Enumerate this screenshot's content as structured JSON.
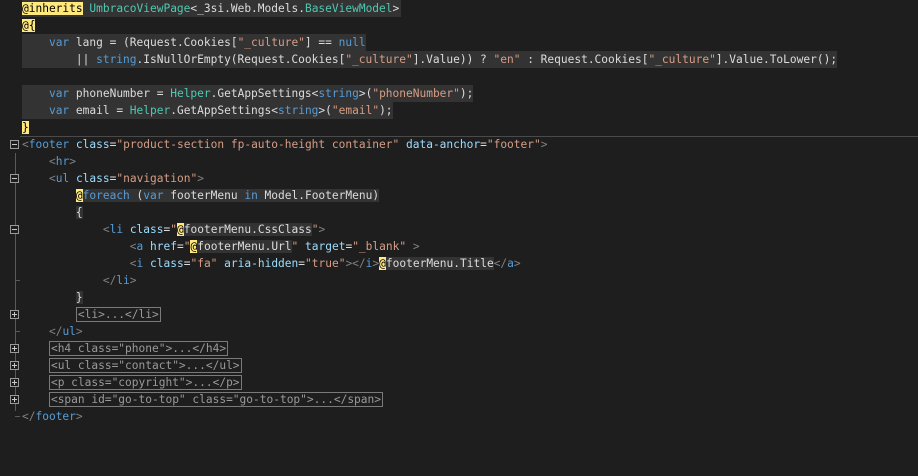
{
  "editor": {
    "lines": [
      {
        "text": "@inherits UmbracoViewPage<_3si.Web.Models.BaseViewModel>"
      },
      {
        "text": "@{"
      },
      {
        "text": "    var lang = (Request.Cookies[\"_culture\"] == null"
      },
      {
        "text": "        || string.IsNullOrEmpty(Request.Cookies[\"_culture\"].Value)) ? \"en\" : Request.Cookies[\"_culture\"].Value.ToLower();"
      },
      {
        "text": ""
      },
      {
        "text": "    var phoneNumber = Helper.GetAppSettings<string>(\"phoneNumber\");"
      },
      {
        "text": "    var email = Helper.GetAppSettings<string>(\"email\");"
      },
      {
        "text": "}"
      },
      {
        "text": "<footer class=\"product-section fp-auto-height container\" data-anchor=\"footer\">"
      },
      {
        "text": "    <hr>"
      },
      {
        "text": "    <ul class=\"navigation\">"
      },
      {
        "text": "        @foreach (var footerMenu in Model.FooterMenu)"
      },
      {
        "text": "        {"
      },
      {
        "text": "            <li class=\"@footerMenu.CssClass\">"
      },
      {
        "text": "                <a href=\"@footerMenu.Url\" target=\"_blank\" >"
      },
      {
        "text": "                <i class=\"fa\" aria-hidden=\"true\"></i>@footerMenu.Title</a>"
      },
      {
        "text": "            </li>"
      },
      {
        "text": "        }"
      },
      {
        "text": "        <li>...</li>"
      },
      {
        "text": "    </ul>"
      },
      {
        "text": "    <h4 class=\"phone\">...</h4>"
      },
      {
        "text": "    <ul class=\"contact\">...</ul>"
      },
      {
        "text": "    <p class=\"copyright\">...</p>"
      },
      {
        "text": "    <span id=\"go-to-top\" class=\"go-to-top\">...</span>"
      },
      {
        "text": "</footer>"
      }
    ]
  },
  "theme": {
    "background": "#1e1e1e",
    "keyword": "#569cd6",
    "type": "#4ec9b0",
    "string": "#d69d85",
    "attribute": "#9cdcfe",
    "razor_transition": "#ffe97f",
    "razor_block_bg": "#333333"
  },
  "icons": [
    "fold-collapse-icon",
    "fold-expand-icon"
  ]
}
